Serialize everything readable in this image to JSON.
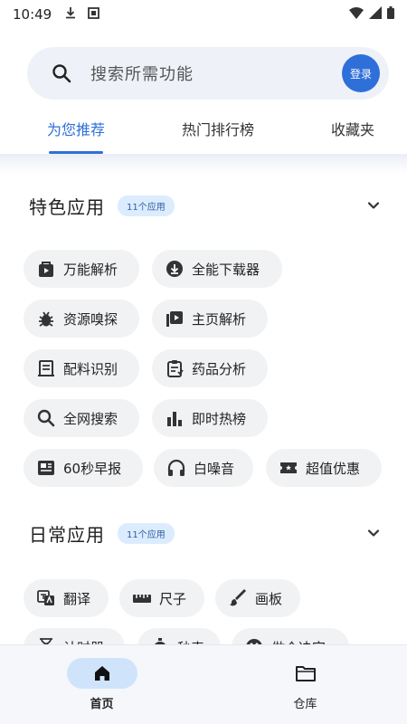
{
  "status_bar": {
    "time": "10:49"
  },
  "search": {
    "placeholder": "搜索所需功能",
    "login_label": "登录"
  },
  "tabs": [
    {
      "label": "为您推荐",
      "active": true
    },
    {
      "label": "热门排行榜",
      "active": false
    },
    {
      "label": "收藏夹",
      "active": false
    }
  ],
  "sections": {
    "featured": {
      "title": "特色应用",
      "count": "11个应用",
      "items": [
        {
          "label": "万能解析",
          "icon": "play-bag-icon"
        },
        {
          "label": "全能下载器",
          "icon": "download-circle-icon"
        },
        {
          "label": "资源嗅探",
          "icon": "bug-icon"
        },
        {
          "label": "主页解析",
          "icon": "video-library-icon"
        },
        {
          "label": "配料识别",
          "icon": "document-icon"
        },
        {
          "label": "药品分析",
          "icon": "clipboard-icon"
        },
        {
          "label": "全网搜索",
          "icon": "search-icon"
        },
        {
          "label": "即时热榜",
          "icon": "bar-chart-icon"
        },
        {
          "label": "60秒早报",
          "icon": "news-icon"
        },
        {
          "label": "白噪音",
          "icon": "headphones-icon"
        },
        {
          "label": "超值优惠",
          "icon": "ticket-icon"
        }
      ]
    },
    "daily": {
      "title": "日常应用",
      "count": "11个应用",
      "items": [
        {
          "label": "翻译",
          "icon": "translate-icon"
        },
        {
          "label": "尺子",
          "icon": "ruler-icon"
        },
        {
          "label": "画板",
          "icon": "brush-icon"
        },
        {
          "label": "计时器",
          "icon": "timer-icon"
        },
        {
          "label": "秒表",
          "icon": "stopwatch-icon"
        },
        {
          "label": "做个决定",
          "icon": "dice-icon"
        }
      ]
    }
  },
  "bottom_nav": [
    {
      "label": "首页",
      "icon": "home-icon",
      "active": true
    },
    {
      "label": "仓库",
      "icon": "folder-icon",
      "active": false
    }
  ],
  "colors": {
    "accent": "#2f6fd9",
    "chip_bg": "#f1f2f4",
    "badge_bg": "#dcecff",
    "nav_active_bg": "#cfe4fb"
  }
}
